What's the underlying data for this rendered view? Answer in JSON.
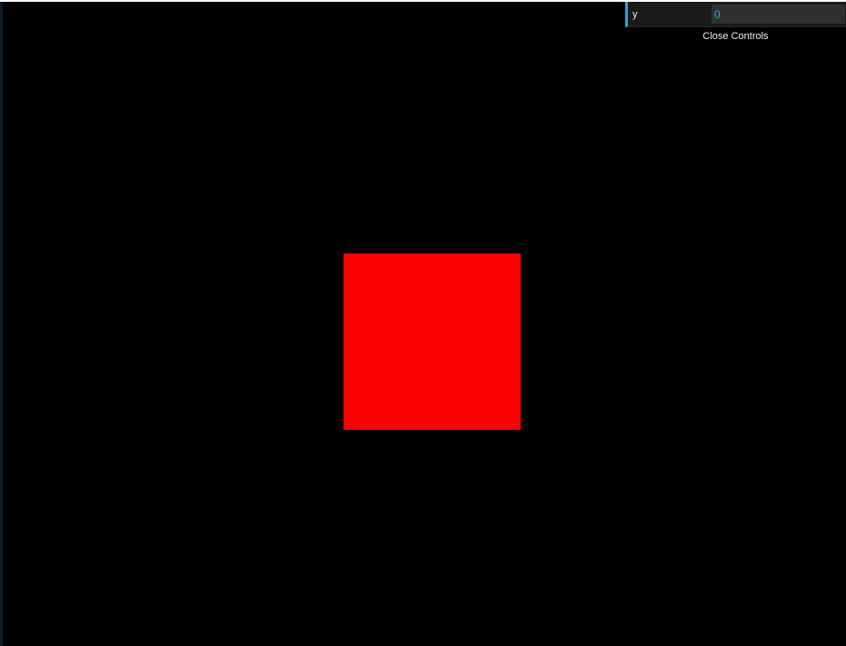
{
  "controls": {
    "param_label": "y",
    "param_value": "0",
    "close_label": "Close Controls",
    "accent_color": "#2fa1d6"
  },
  "scene": {
    "background_color": "#000000",
    "shape": "square",
    "shape_color": "#ff0000"
  }
}
